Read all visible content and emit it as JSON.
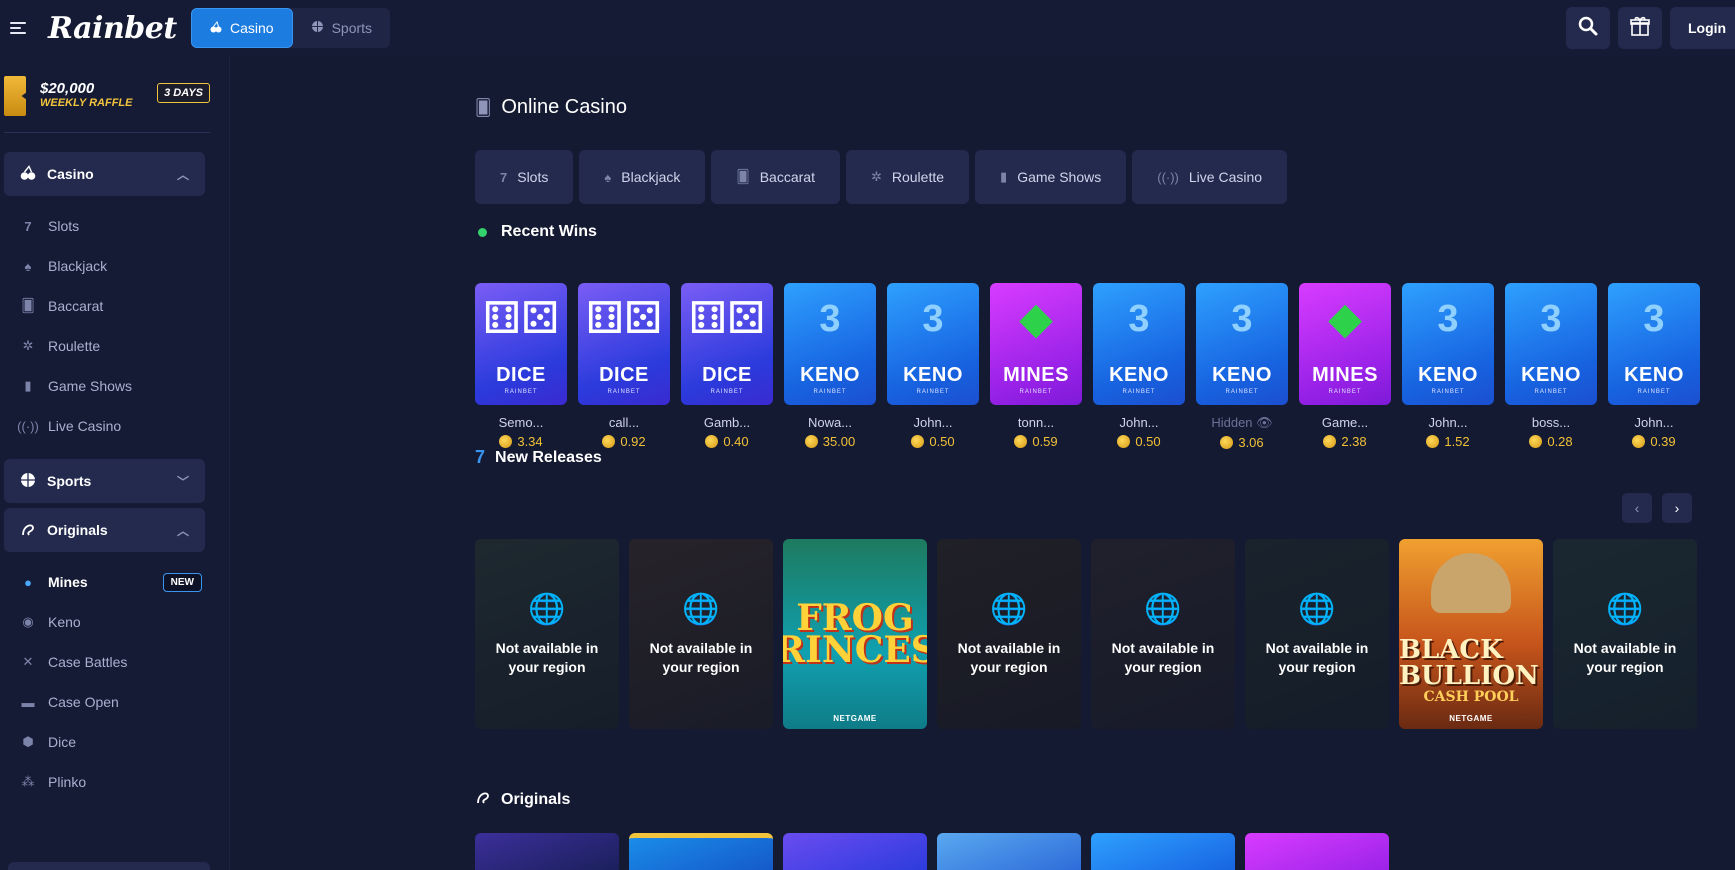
{
  "header": {
    "logo": "Rainbet",
    "tabs": [
      {
        "label": "Casino",
        "icon": "cherries-icon"
      },
      {
        "label": "Sports",
        "icon": "basketball-icon"
      }
    ],
    "login_label": "Login"
  },
  "sidebar": {
    "raffle": {
      "amount": "$20,000",
      "label": "WEEKLY RAFFLE",
      "badge": "3 DAYS"
    },
    "casino": {
      "label": "Casino",
      "items": [
        {
          "label": "Slots",
          "icon": "seven-icon"
        },
        {
          "label": "Blackjack",
          "icon": "spade-icon"
        },
        {
          "label": "Baccarat",
          "icon": "cards-icon"
        },
        {
          "label": "Roulette",
          "icon": "roulette-icon"
        },
        {
          "label": "Game Shows",
          "icon": "microphone-icon"
        },
        {
          "label": "Live Casino",
          "icon": "broadcast-icon"
        }
      ]
    },
    "sports": {
      "label": "Sports"
    },
    "originals": {
      "label": "Originals",
      "items": [
        {
          "label": "Mines",
          "badge": "NEW"
        },
        {
          "label": "Keno"
        },
        {
          "label": "Case Battles"
        },
        {
          "label": "Case Open"
        },
        {
          "label": "Dice"
        },
        {
          "label": "Plinko"
        }
      ]
    }
  },
  "main": {
    "title": "Online Casino",
    "categories": [
      {
        "label": "Slots"
      },
      {
        "label": "Blackjack"
      },
      {
        "label": "Baccarat"
      },
      {
        "label": "Roulette"
      },
      {
        "label": "Game Shows"
      },
      {
        "label": "Live Casino"
      }
    ],
    "recent_wins": {
      "title": "Recent Wins",
      "items": [
        {
          "game": "DICE",
          "brand": "RAINBET",
          "type": "dice",
          "user": "Semo...",
          "amount": "3.34"
        },
        {
          "game": "DICE",
          "brand": "RAINBET",
          "type": "dice",
          "user": "call...",
          "amount": "0.92"
        },
        {
          "game": "DICE",
          "brand": "RAINBET",
          "type": "dice",
          "user": "Gamb...",
          "amount": "0.40"
        },
        {
          "game": "KENO",
          "brand": "RAINBET",
          "type": "keno",
          "user": "Nowa...",
          "amount": "35.00"
        },
        {
          "game": "KENO",
          "brand": "RAINBET",
          "type": "keno",
          "user": "John...",
          "amount": "0.50"
        },
        {
          "game": "MINES",
          "brand": "RAINBET",
          "type": "mines",
          "user": "tonn...",
          "amount": "0.59"
        },
        {
          "game": "KENO",
          "brand": "RAINBET",
          "type": "keno",
          "user": "John...",
          "amount": "0.50"
        },
        {
          "game": "KENO",
          "brand": "RAINBET",
          "type": "keno",
          "user": "Hidden",
          "amount": "3.06"
        },
        {
          "game": "MINES",
          "brand": "RAINBET",
          "type": "mines",
          "user": "Game...",
          "amount": "2.38"
        },
        {
          "game": "KENO",
          "brand": "RAINBET",
          "type": "keno",
          "user": "John...",
          "amount": "1.52"
        },
        {
          "game": "KENO",
          "brand": "RAINBET",
          "type": "keno",
          "user": "boss...",
          "amount": "0.28"
        },
        {
          "game": "KENO",
          "brand": "RAINBET",
          "type": "keno",
          "user": "John...",
          "amount": "0.39"
        }
      ]
    },
    "new_releases": {
      "title": "New Releases",
      "locked_text": "Not available in your region",
      "frog_title": "FROG PRINCESS",
      "frog_provider": "NETGAME",
      "bullion_title": "BLACK BULLION",
      "bullion_sub": "CASH POOL",
      "bullion_provider": "NETGAME"
    },
    "originals_title": "Originals"
  },
  "colors": {
    "accent": "#1d7ce0",
    "bg": "#151a33",
    "panel": "#232a4d",
    "coin": "#f0c136",
    "online": "#34d26c"
  }
}
